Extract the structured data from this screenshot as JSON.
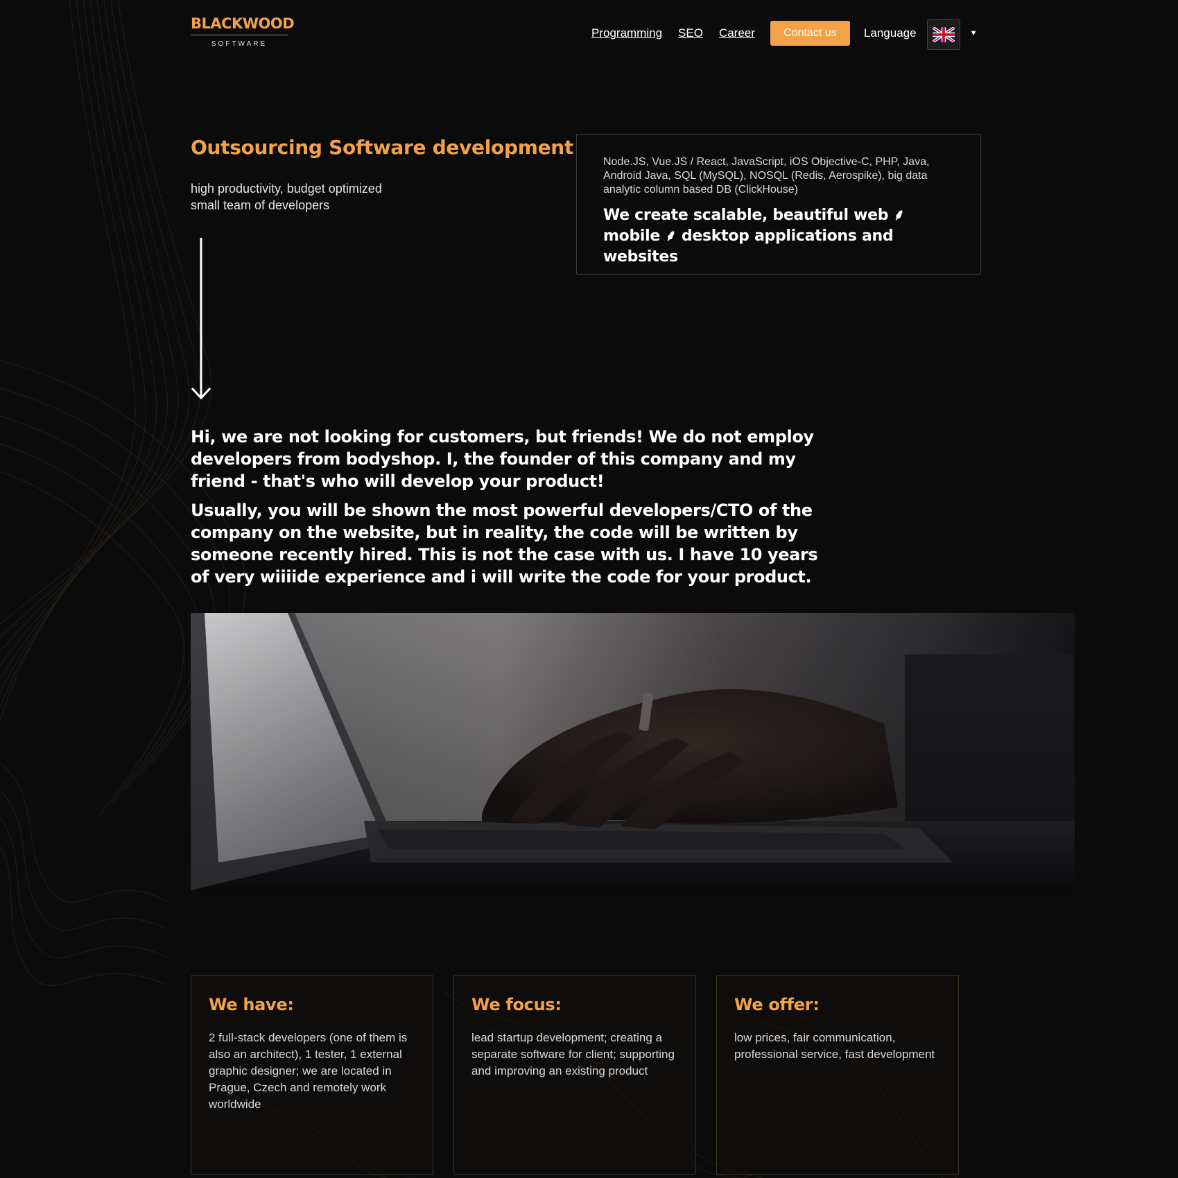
{
  "header": {
    "logo_main": "BLACKWOOD",
    "logo_sub": "SOFTWARE",
    "nav": [
      "Programming",
      "SEO",
      "Career"
    ],
    "contact_label": "Contact us",
    "language_label": "Language"
  },
  "hero": {
    "title": "Outsourcing Software development",
    "subtitle_line1": "high productivity, budget optimized",
    "subtitle_line2": "small team of developers",
    "tech_list": "Node.JS, Vue.JS / React, JavaScript, iOS Objective-C, PHP, Java, Android Java, SQL (MySQL), NOSQL (Redis, Aerospike), big data analytic column based DB (ClickHouse)",
    "headline_part1": "We create scalable, beautiful web ",
    "headline_part2": " mobile ",
    "headline_part3": " desktop applications and websites",
    "separator_glyph": "⸙"
  },
  "intro": {
    "paragraph1": "Hi, we are not looking for customers, but friends! We do not employ developers from bodyshop. I, the founder of this company and my friend - that's who will develop your product!",
    "paragraph2": "Usually, you will be shown the most powerful developers/CTO of the company on the website, but in reality, the code will be written by someone recently hired. This is not the case with us. I have 10 years of very wiiiide experience and i will write the code for your product."
  },
  "cards": [
    {
      "title": "We have:",
      "text": "2 full-stack developers (one of them is also an architect), 1 tester, 1 external graphic designer; we are located in Prague, Czech and remotely work worldwide"
    },
    {
      "title": "We focus:",
      "text": "lead startup development; creating a separate software for client; supporting and improving an existing product"
    },
    {
      "title": "We offer:",
      "text": "low prices, fair communication, professional service, fast development"
    }
  ],
  "colors": {
    "background": "#0b0b0c",
    "accent": "#f4a24a",
    "text": "#ffffff",
    "muted_text": "#d8d8d8"
  },
  "icons": {
    "flag": "uk-flag-icon",
    "caret": "caret-down-icon",
    "arrow": "arrow-down-icon"
  }
}
